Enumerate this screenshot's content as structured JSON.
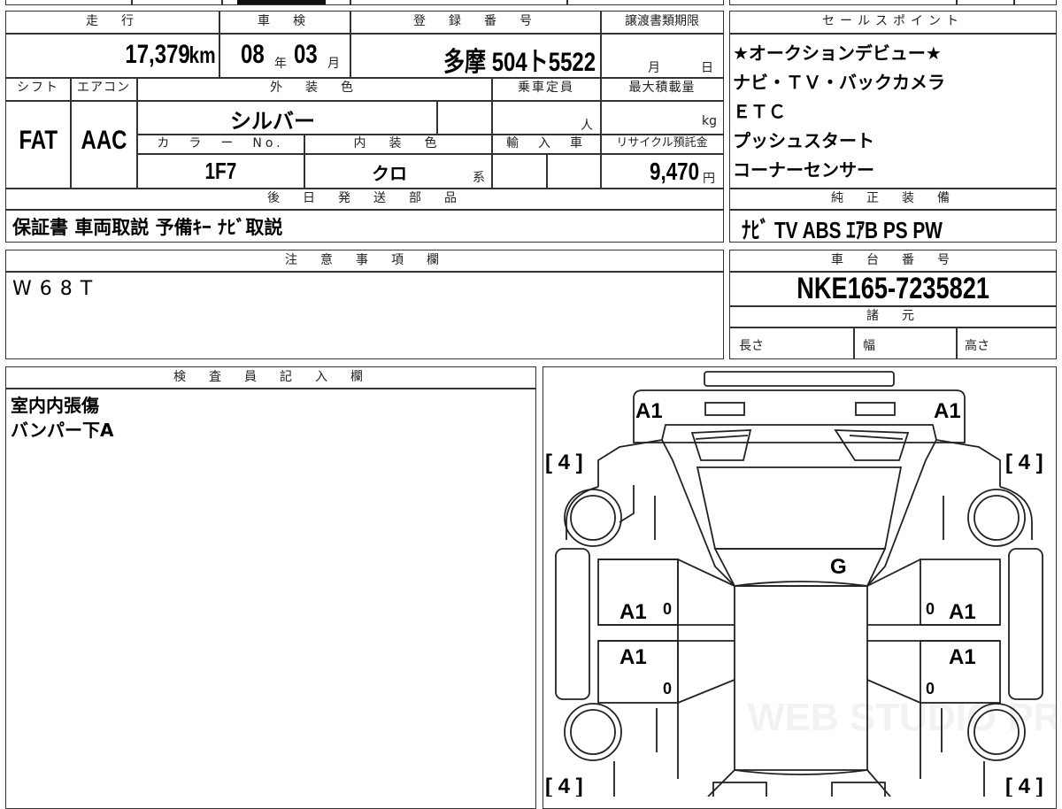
{
  "headers": {
    "mileage": "走　行",
    "inspection": "車　検",
    "registration": "登　録　番　号",
    "transfer_deadline": "譲渡書類期限",
    "sales_points": "セールスポイント",
    "shift": "シフト",
    "aircon": "エアコン",
    "exterior_color": "外　装　色",
    "capacity": "乗車定員",
    "max_load": "最大積載量",
    "color_no": "カ　ラ　ー　No.",
    "interior_color": "内　装　色",
    "import": "輸　入　車",
    "recycle": "リサイクル預託金",
    "later_parts": "後　日　発　送　部　品",
    "genuine_equipment": "純　正　装　備",
    "notes": "注　意　事　項　欄",
    "chassis_no": "車　台　番　号",
    "specs": "諸　元",
    "inspector": "検　査　員　記　入　欄"
  },
  "values": {
    "mileage": "17,379",
    "mileage_unit": "km",
    "inspection_year": "08",
    "year_unit": "年",
    "inspection_month": "03",
    "month_unit": "月",
    "registration": "多摩 504ト5522",
    "transfer_month": "月",
    "transfer_day": "日",
    "shift": "FAT",
    "aircon": "AAC",
    "exterior_color": "シルバー",
    "capacity_unit": "人",
    "max_load_unit": "kg",
    "color_no": "1F7",
    "interior_color": "クロ",
    "interior_suffix": "系",
    "recycle": "9,470",
    "recycle_unit": "円",
    "later_parts": "保証書 車両取説 予備ｷｰ ﾅﾋﾞ取説",
    "genuine_equipment": "ﾅﾋﾞ TV ABS ｴｱB PS PW",
    "notes": "W68T",
    "chassis_no": "NKE165-7235821",
    "spec_length": "長さ",
    "spec_width": "幅",
    "spec_height": "高さ",
    "inspector_line1": "室内内張傷",
    "inspector_line2": "バンパー下A"
  },
  "sales_points": [
    "★オークションデビュー★",
    "ナビ・ＴＶ・バックカメラ",
    "ＥＴＣ",
    "プッシュスタート",
    "コーナーセンサー"
  ],
  "diagram": {
    "front_left": "A1",
    "front_right": "A1",
    "side_left_upper": "A1",
    "side_right_upper": "A1",
    "side_left_lower": "A1",
    "side_right_lower": "A1",
    "windshield": "G",
    "bracket_tl": "[ 4 ]",
    "bracket_tr": "[ 4 ]",
    "bracket_bl": "[ 4 ]",
    "bracket_br": "[ 4 ]",
    "zero": "0",
    "watermark": "WEB STUDIO PRO"
  }
}
